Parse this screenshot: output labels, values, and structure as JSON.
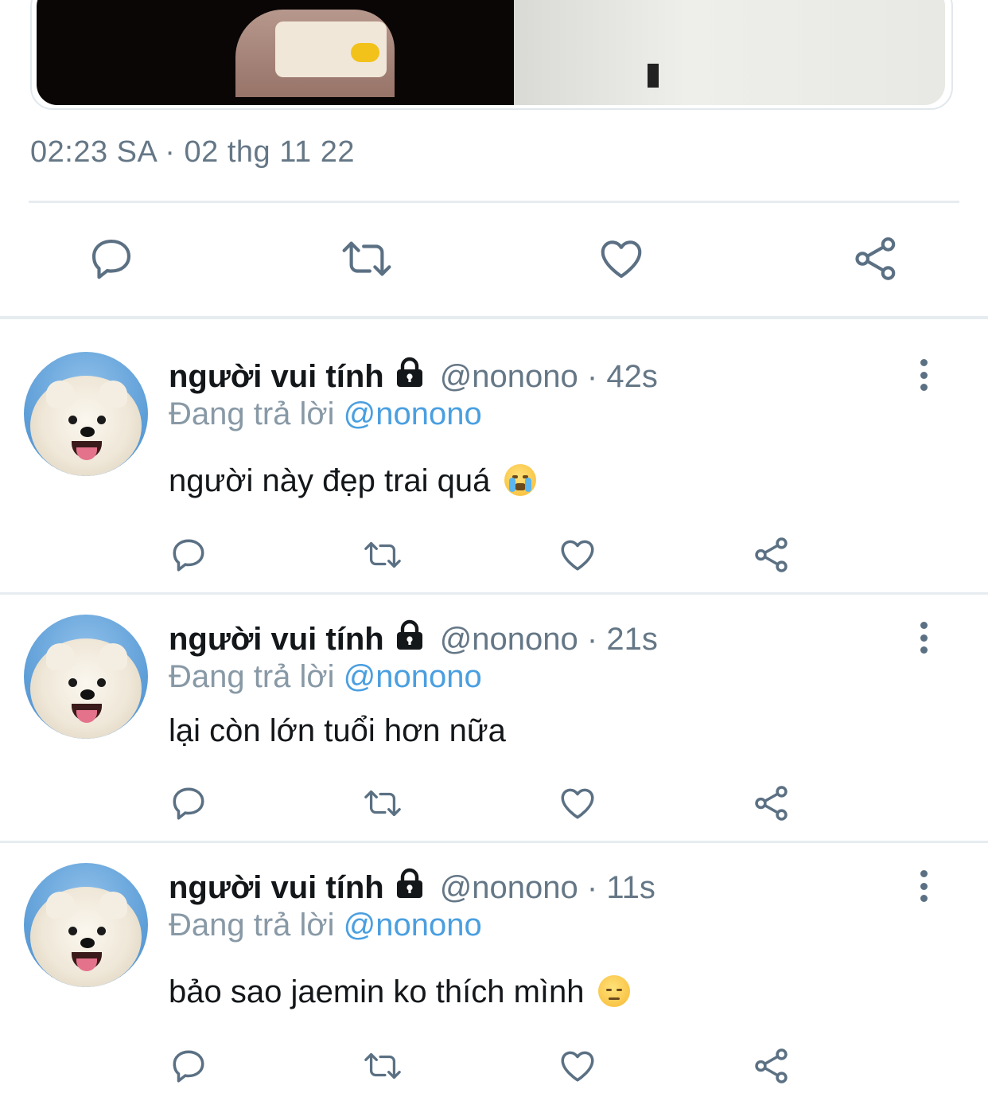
{
  "tweet": {
    "timestamp": "02:23 SA · 02 thg 11 22",
    "actions": [
      {
        "icon": "reply-icon"
      },
      {
        "icon": "retweet-icon"
      },
      {
        "icon": "like-icon"
      },
      {
        "icon": "share-icon"
      }
    ]
  },
  "replies": [
    {
      "name": "người vui tính",
      "handle_time": "@nonono · 42s",
      "replying_prefix": "Đang trả lời",
      "replying_to": "@nonono",
      "text": "người này đẹp trai quá",
      "emoji": "loudly-crying-face"
    },
    {
      "name": "người vui tính",
      "handle_time": "@nonono · 21s",
      "replying_prefix": "Đang trả lời",
      "replying_to": "@nonono",
      "text": "lại còn lớn tuổi hơn nữa",
      "emoji": ""
    },
    {
      "name": "người vui tính",
      "handle_time": "@nonono · 11s",
      "replying_prefix": "Đang trả lời",
      "replying_to": "@nonono",
      "text": "bảo sao jaemin ko thích mình",
      "emoji": "pensive-face"
    }
  ],
  "colors": {
    "icon": "#5b7083",
    "mention": "#4a9fe0",
    "secondary_text": "#657786",
    "divider": "#e6ecf0"
  }
}
